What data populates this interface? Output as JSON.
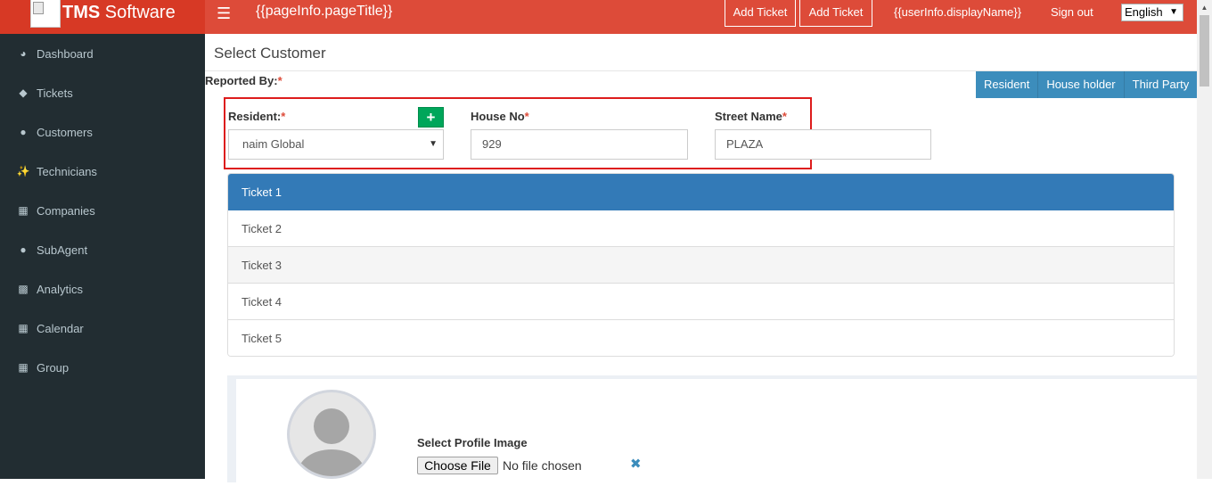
{
  "header": {
    "brand_bold": "TMS",
    "brand_rest": " Software",
    "menu_icon": "bars-icon",
    "page_title": "{{pageInfo.pageTitle}}",
    "add_ticket_1": "Add Ticket",
    "add_ticket_2": "Add Ticket",
    "user_display": "{{userInfo.displayName}}",
    "sign_out": "Sign out",
    "language": "English"
  },
  "sidebar": {
    "items": [
      {
        "label": "Dashboard",
        "icon": "dashboard-icon"
      },
      {
        "label": "Tickets",
        "icon": "tag-icon"
      },
      {
        "label": "Customers",
        "icon": "user-icon"
      },
      {
        "label": "Technicians",
        "icon": "wrench-icon"
      },
      {
        "label": "Companies",
        "icon": "calendar-icon"
      },
      {
        "label": "SubAgent",
        "icon": "user-icon"
      },
      {
        "label": "Analytics",
        "icon": "bar-chart-icon"
      },
      {
        "label": "Calendar",
        "icon": "calendar-icon"
      },
      {
        "label": "Group",
        "icon": "calendar-icon"
      }
    ]
  },
  "main": {
    "section_title": "Select Customer",
    "reported_by": "Reported By:",
    "required_mark": "*",
    "tabs": [
      "Resident",
      "House holder",
      "Third Party"
    ],
    "resident_label": "Resident:",
    "resident_value": "naim Global",
    "house_no_label": "House No",
    "house_no_value": "929",
    "street_name_label": "Street Name",
    "street_name_value": "PLAZA",
    "tickets": [
      "Ticket 1",
      "Ticket 2",
      "Ticket 3",
      "Ticket 4",
      "Ticket 5"
    ],
    "select_profile_label": "Select Profile Image",
    "choose_file": "Choose File",
    "no_file": "No file chosen"
  },
  "colors": {
    "header": "#dd4b39",
    "sidebar": "#222d32",
    "accent": "#337ab7",
    "add_button": "#00a65a"
  }
}
